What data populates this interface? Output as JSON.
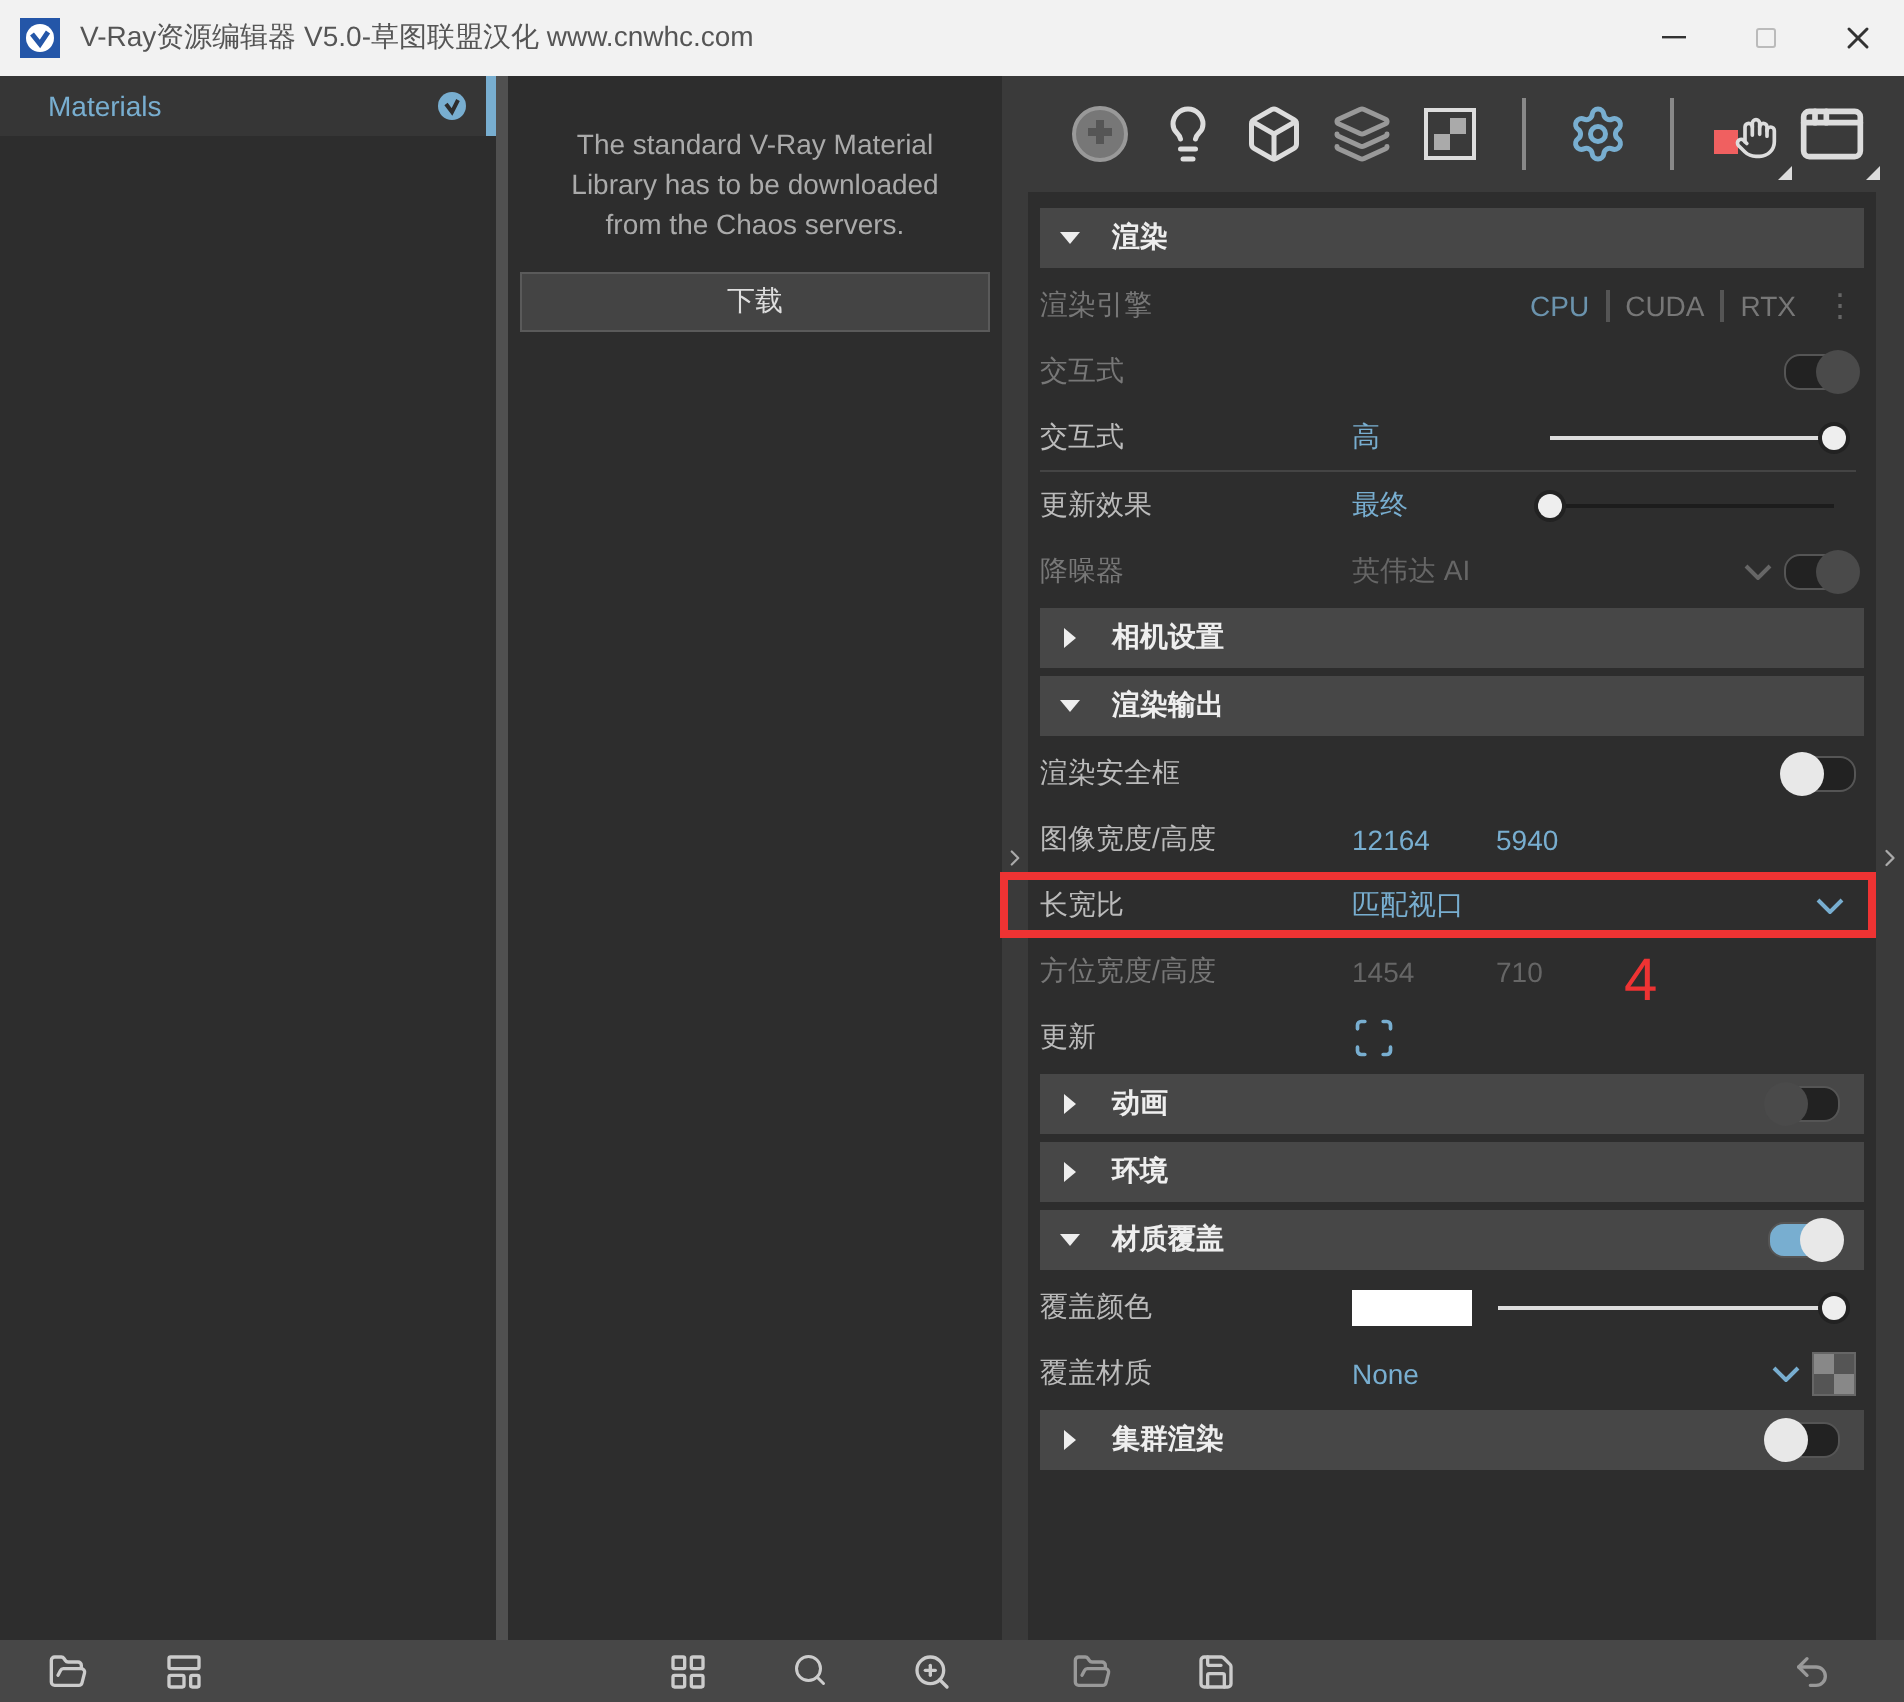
{
  "window": {
    "title": "V-Ray资源编辑器 V5.0-草图联盟汉化 www.cnwhc.com"
  },
  "library": {
    "items": [
      {
        "label": "Materials",
        "selected": true
      }
    ]
  },
  "download": {
    "message": "The standard V-Ray Material Library has to be downloaded from the Chaos servers.",
    "button": "下载"
  },
  "toolbar": {
    "tools": [
      {
        "kind": "materials",
        "selected": false
      },
      {
        "kind": "lights",
        "selected": false
      },
      {
        "kind": "geometry",
        "selected": false
      },
      {
        "kind": "layers",
        "selected": false
      },
      {
        "kind": "textures",
        "selected": false
      },
      {
        "kind": "settings",
        "selected": true
      },
      {
        "kind": "render",
        "selected": false
      },
      {
        "kind": "frame-buffer",
        "selected": false
      }
    ]
  },
  "settings": [
    {
      "kind": "section",
      "label": "渲染",
      "expanded": true
    },
    {
      "kind": "engine",
      "label": "渲染引擎",
      "disabled": true,
      "more": "⋮",
      "options": [
        {
          "label": "CPU",
          "selected": true
        },
        {
          "label": "CUDA",
          "selected": false
        },
        {
          "label": "RTX",
          "selected": false
        }
      ]
    },
    {
      "kind": "toggle",
      "label": "交互式",
      "disabled": true,
      "toggle": {
        "on": true,
        "disabled": true
      }
    },
    {
      "kind": "slider",
      "label": "交互式",
      "value": "高",
      "level": 1
    },
    {
      "kind": "slider",
      "label": "更新效果",
      "value": "最终",
      "level": 0,
      "divider_before": true
    },
    {
      "kind": "dropdown-toggle",
      "label": "降噪器",
      "value": "英伟达 AI",
      "disabled": true,
      "toggle": {
        "on": true,
        "disabled": true
      }
    },
    {
      "kind": "section",
      "label": "相机设置",
      "expanded": false
    },
    {
      "kind": "section",
      "label": "渲染输出",
      "expanded": true
    },
    {
      "kind": "toggle",
      "label": "渲染安全框",
      "toggle": {
        "on": false,
        "disabled": false
      }
    },
    {
      "kind": "pair",
      "label": "图像宽度/高度",
      "values": [
        "12164",
        "5940"
      ]
    },
    {
      "kind": "dropdown",
      "label": "长宽比",
      "value": "匹配视口",
      "highlighted": true,
      "annotation": "4"
    },
    {
      "kind": "pair",
      "label": "方位宽度/高度",
      "values": [
        "1454",
        "710"
      ],
      "disabled": true
    },
    {
      "kind": "button",
      "label": "更新"
    },
    {
      "kind": "section",
      "label": "动画",
      "expanded": false,
      "toggle": {
        "on": false,
        "disabled": true
      }
    },
    {
      "kind": "section",
      "label": "环境",
      "expanded": false
    },
    {
      "kind": "section",
      "label": "材质覆盖",
      "expanded": true,
      "toggle": {
        "on": true,
        "disabled": false
      }
    },
    {
      "kind": "color",
      "label": "覆盖颜色",
      "color": "#ffffff",
      "level": 1
    },
    {
      "kind": "material",
      "label": "覆盖材质",
      "value": "None"
    },
    {
      "kind": "section",
      "label": "集群渲染",
      "expanded": false,
      "toggle": {
        "on": false,
        "disabled": false
      }
    }
  ]
}
